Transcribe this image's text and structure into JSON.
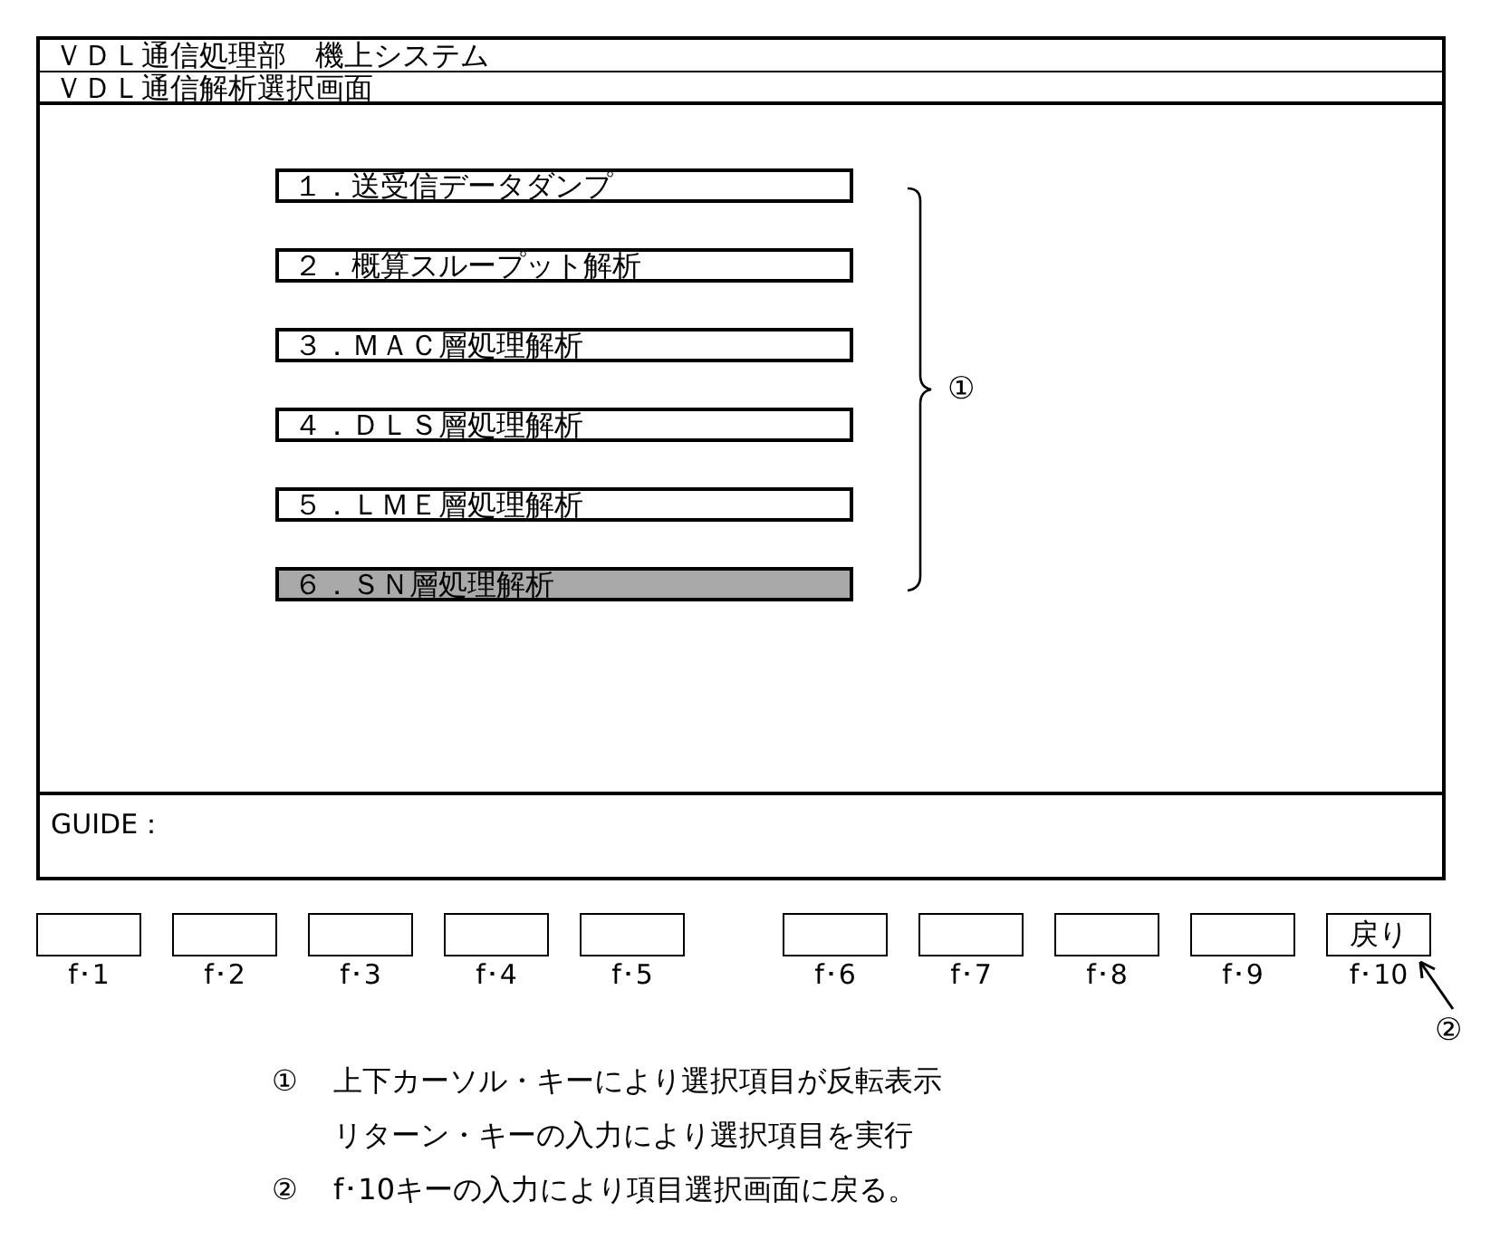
{
  "header": {
    "system_title": "ＶＤＬ通信処理部　機上システム",
    "screen_title": "ＶＤＬ通信解析選択画面"
  },
  "menu": {
    "items": [
      {
        "label": "１．送受信データダンプ",
        "selected": false
      },
      {
        "label": "２．概算スループット解析",
        "selected": false
      },
      {
        "label": "３．ＭＡＣ層処理解析",
        "selected": false
      },
      {
        "label": "４．ＤＬＳ層処理解析",
        "selected": false
      },
      {
        "label": "５．ＬＭＥ層処理解析",
        "selected": false
      },
      {
        "label": "６．ＳＮ層処理解析",
        "selected": true
      }
    ],
    "callout": "①"
  },
  "guide": {
    "label": "GUIDE："
  },
  "function_keys": {
    "groups": [
      [
        {
          "label": "f･1"
        },
        {
          "label": "f･2"
        },
        {
          "label": "f･3"
        },
        {
          "label": "f･4"
        },
        {
          "label": "f･5"
        }
      ],
      [
        {
          "label": "f･6"
        },
        {
          "label": "f･7"
        },
        {
          "label": "f･8"
        },
        {
          "label": "f･9"
        },
        {
          "label": "f･10",
          "caption": "戻り",
          "callout": "②"
        }
      ]
    ]
  },
  "notes": [
    {
      "marker": "①",
      "lines": [
        "上下カーソル・キーにより選択項目が反転表示",
        "リターン・キーの入力により選択項目を実行"
      ]
    },
    {
      "marker": "②",
      "lines": [
        "f･10キーの入力により項目選択画面に戻る。"
      ]
    }
  ]
}
